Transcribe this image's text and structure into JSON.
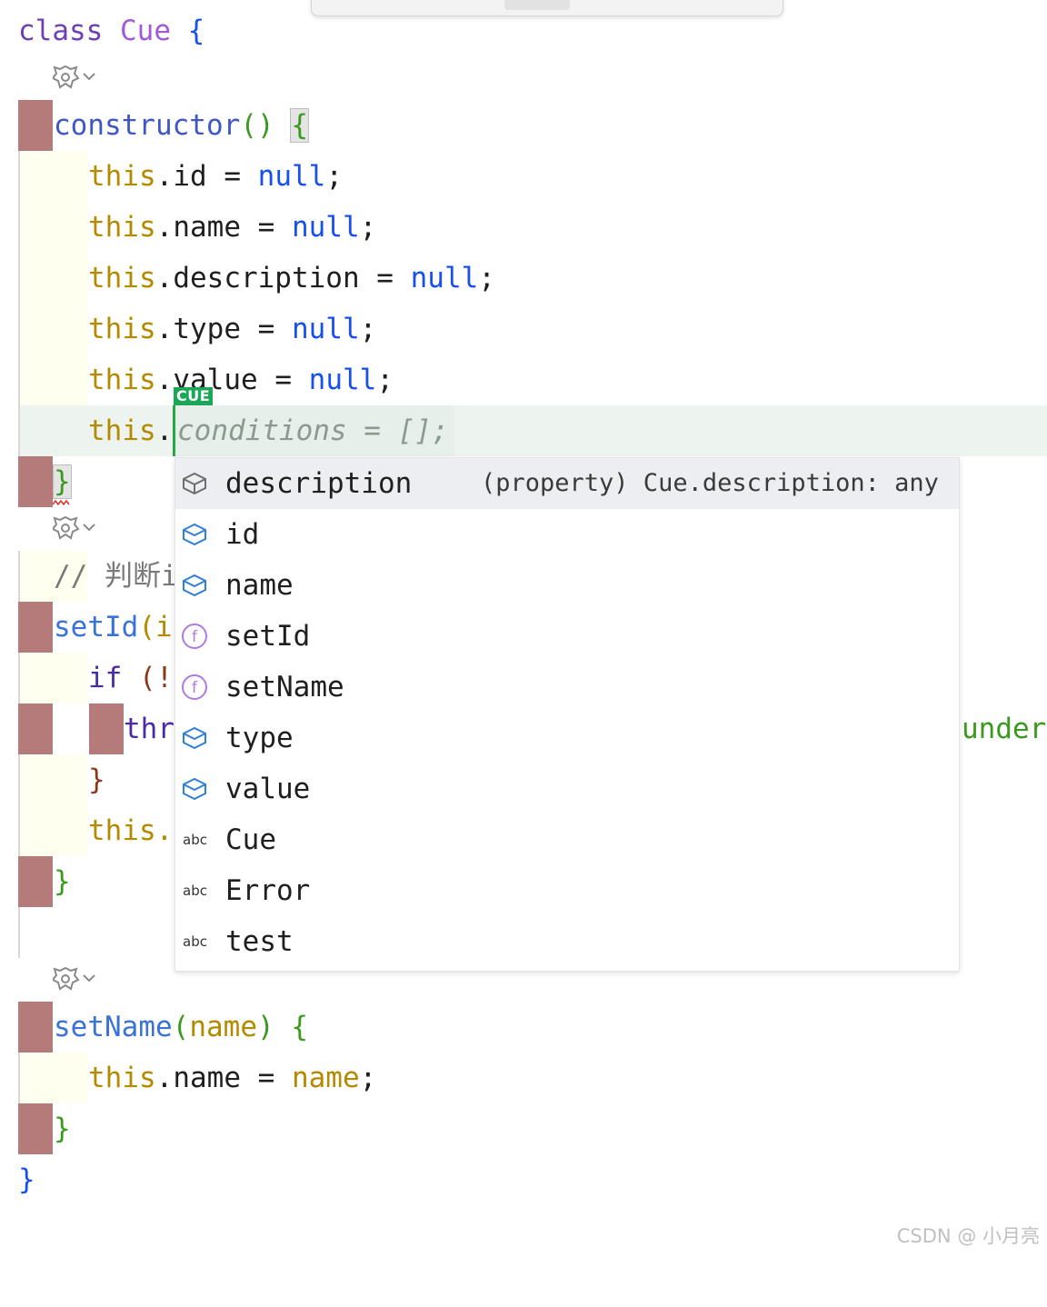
{
  "editor": {
    "lines": {
      "class_kw": "class",
      "class_name": "Cue",
      "open_brace": "{",
      "constructor": "constructor",
      "ctor_parens": "()",
      "ctor_brace": "{",
      "this_kw": "this",
      "dot": ".",
      "assign_null": " = ",
      "null_kw": "null",
      "semi": ";",
      "prop_id": "id",
      "prop_name": "name",
      "prop_description": "description",
      "prop_type": "type",
      "prop_value": "value",
      "ghost_completion": "conditions = [];",
      "ctor_close": "}",
      "comment_prefix": "// 判断i",
      "setId_name": "setId",
      "setId_args": "(i",
      "if_kw": "if",
      "if_paren": " (!",
      "throw_partial": "thr",
      "under_text": "under",
      "close_brace_if": "}",
      "this_partial": "this.",
      "setId_close": "}",
      "setName_name": "setName",
      "setName_open": "(",
      "setName_param": "name",
      "setName_close_paren": ")",
      "setName_brace": "{",
      "setName_body_prop": "name",
      "setName_body_value": "name",
      "setName_close": "}",
      "class_close": "}"
    },
    "cue_badge": "CUE"
  },
  "completion_popup": {
    "items": [
      {
        "icon": "property-icon",
        "label": "description",
        "hint": "(property) Cue.description: any",
        "selected": true
      },
      {
        "icon": "property-icon",
        "label": "id"
      },
      {
        "icon": "property-icon",
        "label": "name"
      },
      {
        "icon": "function-icon",
        "label": "setId",
        "icon_text": "f"
      },
      {
        "icon": "function-icon",
        "label": "setName",
        "icon_text": "f"
      },
      {
        "icon": "property-icon",
        "label": "type"
      },
      {
        "icon": "property-icon",
        "label": "value"
      },
      {
        "icon": "text-icon",
        "label": "Cue",
        "icon_text": "abc"
      },
      {
        "icon": "text-icon",
        "label": "Error",
        "icon_text": "abc"
      },
      {
        "icon": "text-icon",
        "label": "test",
        "icon_text": "abc"
      }
    ]
  },
  "watermark": "CSDN @  小月亮",
  "colors": {
    "error_marker": "#b57a7a",
    "caret": "#28a745",
    "cue_badge": "#1aa858",
    "selected_row": "#eceef2"
  }
}
